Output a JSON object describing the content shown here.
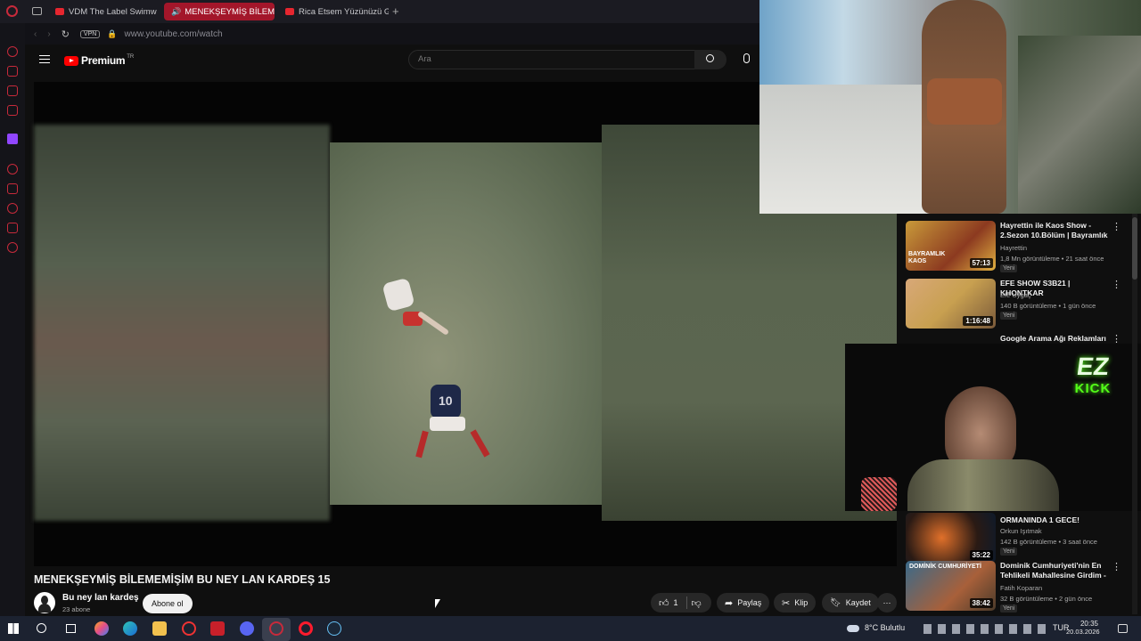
{
  "browser": {
    "tabs": [
      {
        "label": "VDM The Label Swimwear",
        "active": false
      },
      {
        "label": "MENEKŞEYMİŞ BİLEM",
        "active": true
      },
      {
        "label": "Rica Etsem Yüzünüzü Gül",
        "active": false
      }
    ],
    "new_tab": "+",
    "vpn_badge": "VPN",
    "url": "www.youtube.com/watch",
    "accent": "#c72a3b"
  },
  "youtube": {
    "logo_text": "Premium",
    "logo_sup": "TR",
    "search_placeholder": "Ara"
  },
  "video": {
    "title": "MENEKŞEYMİŞ BİLEMEMİŞİM BU NEY LAN KARDEŞ 15",
    "player_number": "10"
  },
  "channel": {
    "name": "Bu ney lan kardeş",
    "subscribers": "23 abone",
    "subscribe_label": "Abone ol"
  },
  "actions": {
    "like_count": "1",
    "share": "Paylaş",
    "clip": "Klip",
    "save": "Kaydet"
  },
  "recommendations": [
    {
      "title": "Hayrettin ile Kaos Show - 2.Sezon 10.Bölüm | Bayramlık ...",
      "channel": "Hayrettin",
      "meta": "1,8 Mn görüntüleme • 21 saat önce",
      "badge": "Yeni",
      "duration": "57:13",
      "thumb_text": "BAYRAMLIK KAOS"
    },
    {
      "title": "EFE SHOW S3B21 | KHONTKAR",
      "channel": "Efe Uygaç",
      "meta": "140 B görüntüleme • 1 gün önce",
      "badge": "Yeni",
      "duration": "1:16:48"
    },
    {
      "title": "Google Arama Ağı Reklamları"
    },
    {
      "title": "ORMANINDA 1 GECE!",
      "channel": "Orkun Işıtmak",
      "meta": "142 B görüntüleme • 3 saat önce",
      "badge": "Yeni",
      "duration": "35:22"
    },
    {
      "title": "Dominik Cumhuriyeti'nin En Tehlikeli Mahallesine Girdim - ...",
      "channel": "Fatih Koparan",
      "meta": "32 B görüntüleme • 2 gün önce",
      "badge": "Yeni",
      "duration": "38:42",
      "thumb_text": "DOMİNİK CUMHURİYETİ"
    }
  ],
  "stream_overlay": {
    "logo_top": "EZ",
    "logo_bottom": "KICK"
  },
  "taskbar": {
    "weather": "8°C Bulutlu",
    "lang": "TUR",
    "time": "20:35",
    "date": "20.03.2026"
  }
}
